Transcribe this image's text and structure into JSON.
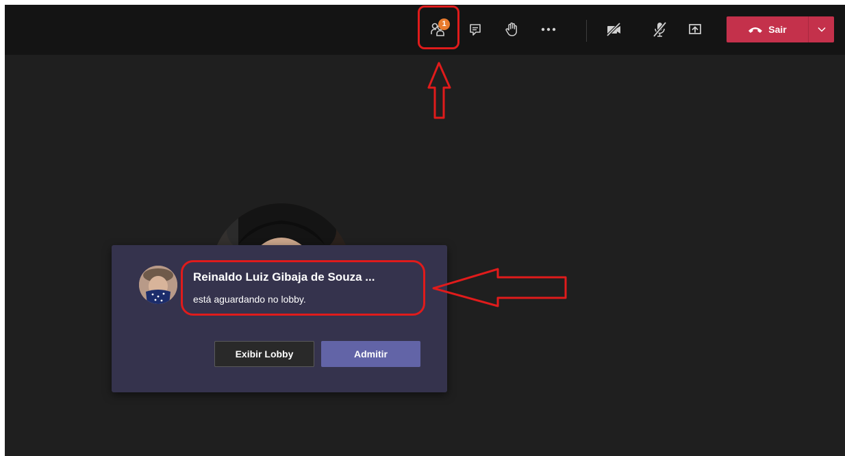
{
  "toolbar": {
    "participants_badge": "1",
    "leave_label": "Sair",
    "icons": [
      "people-icon",
      "chat-icon",
      "raise-hand-icon",
      "more-icon",
      "camera-off-icon",
      "mic-off-icon",
      "share-screen-icon",
      "hang-up-icon",
      "chevron-down-icon"
    ]
  },
  "lobby_notification": {
    "name": "Reinaldo Luiz Gibaja de Souza ...",
    "status": "está aguardando no lobby.",
    "view_lobby_label": "Exibir Lobby",
    "admit_label": "Admitir"
  },
  "colors": {
    "toolbar_bg": "#141414",
    "stage_bg": "#1f1f1f",
    "leave_button": "#c4314b",
    "card_bg": "#35334d",
    "admit_button": "#6264a7",
    "badge": "#e87b2e",
    "annotation": "#e01b1b"
  }
}
